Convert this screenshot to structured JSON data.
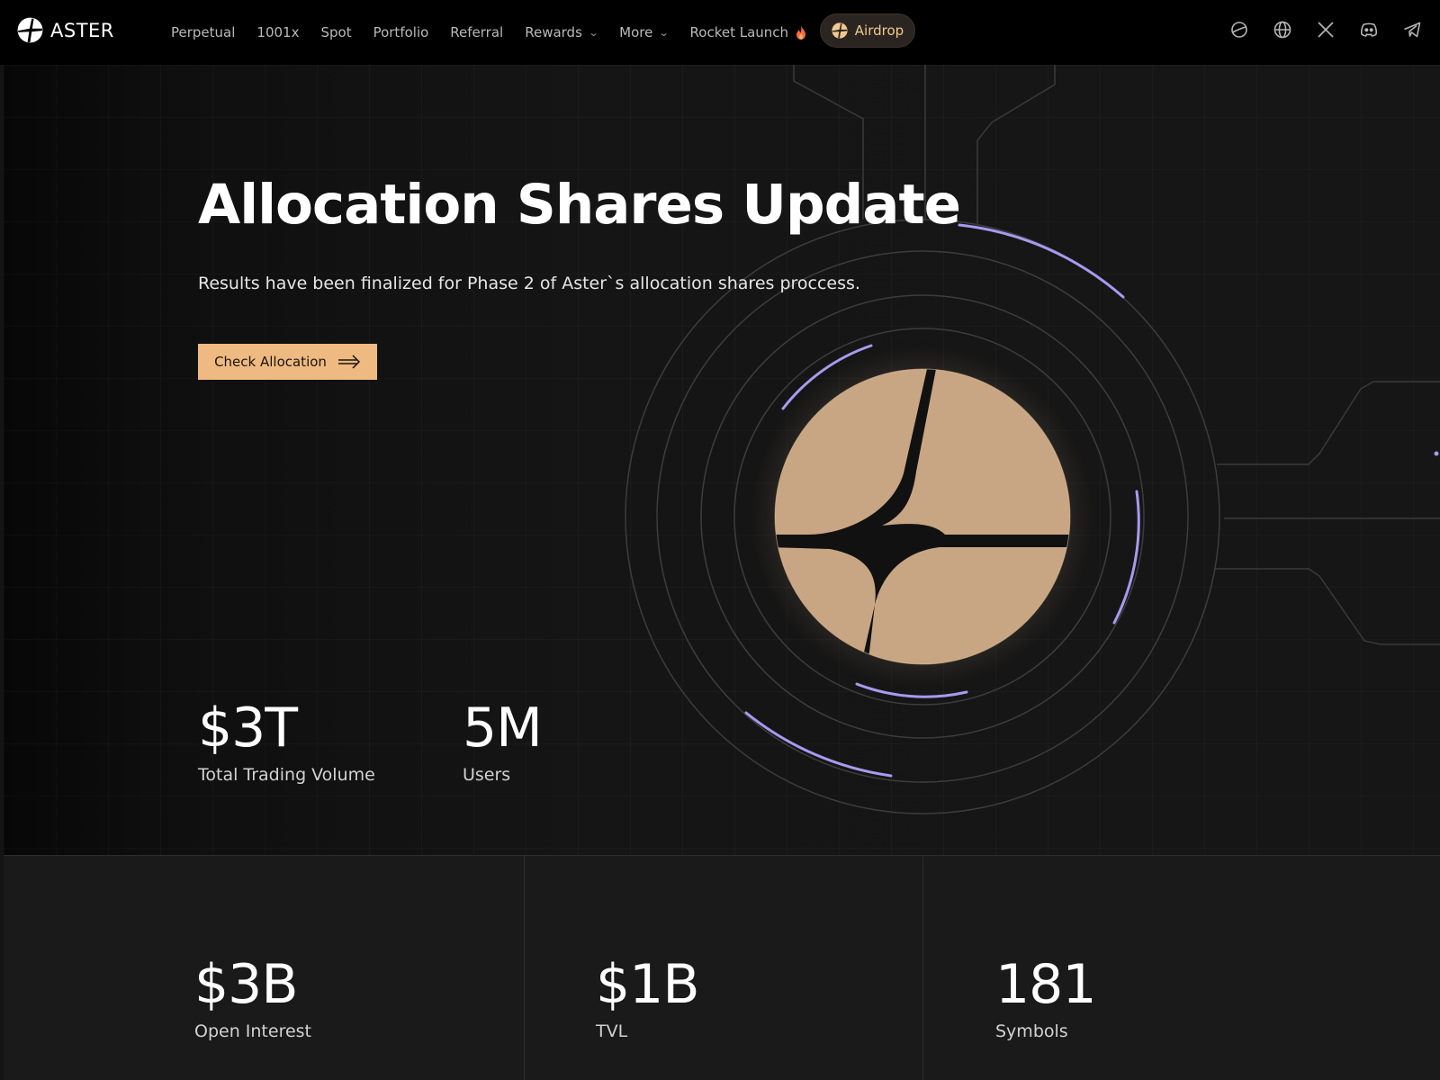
{
  "brand": {
    "name": "ASTER"
  },
  "nav": {
    "items": [
      {
        "label": "Perpetual",
        "has_dropdown": false
      },
      {
        "label": "1001x",
        "has_dropdown": false
      },
      {
        "label": "Spot",
        "has_dropdown": false
      },
      {
        "label": "Portfolio",
        "has_dropdown": false
      },
      {
        "label": "Referral",
        "has_dropdown": false
      },
      {
        "label": "Rewards",
        "has_dropdown": true
      },
      {
        "label": "More",
        "has_dropdown": true
      }
    ],
    "rocket_launch": {
      "label": "Rocket Launch",
      "icon": "flame-icon"
    },
    "airdrop": {
      "label": "Airdrop",
      "icon": "aster-logo-icon"
    },
    "social_icons": [
      "planet-icon",
      "globe-icon",
      "x-icon",
      "discord-icon",
      "telegram-icon"
    ]
  },
  "hero": {
    "title": "Allocation Shares Update",
    "subtitle": "Results have been finalized for Phase 2 of Aster`s allocation shares proccess.",
    "cta_label": "Check Allocation"
  },
  "stats": {
    "total_trading_volume": {
      "value": "$3T",
      "label": "Total Trading Volume"
    },
    "users": {
      "value": "5M",
      "label": "Users"
    },
    "open_interest": {
      "value": "$3B",
      "label": "Open Interest"
    },
    "tvl": {
      "value": "$1B",
      "label": "TVL"
    },
    "symbols": {
      "value": "181",
      "label": "Symbols"
    }
  },
  "colors": {
    "accent": "#efba82",
    "airdrop_text": "#f2c890",
    "ring_highlight": "#a89af0",
    "background": "#141414",
    "logo_fill": "#c9a683"
  }
}
